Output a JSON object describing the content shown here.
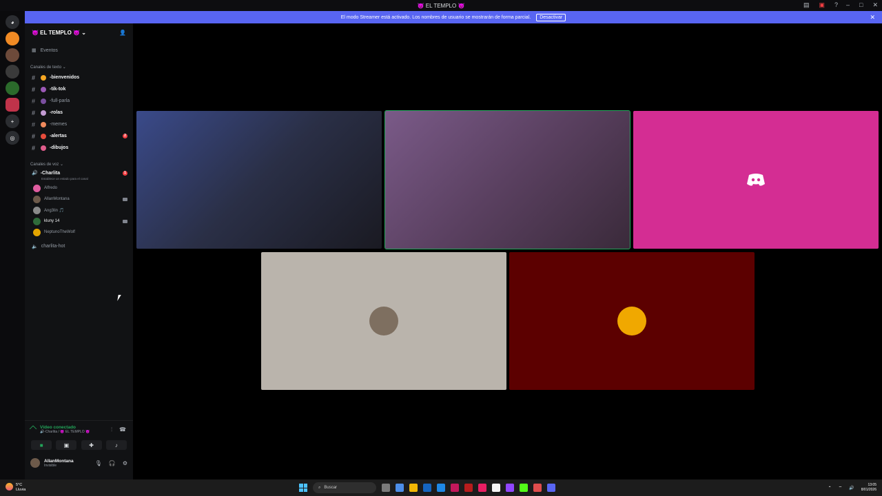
{
  "window": {
    "title": "👿 EL TEMPLO 👿",
    "minimize": "–",
    "maximize": "□",
    "close": "✕"
  },
  "streamer_banner": {
    "text": "El modo Streamer está activado. Los nombres de usuario se mostrarán de forma parcial.",
    "button": "Desactivar",
    "close": "✕"
  },
  "server": {
    "name": "👿 EL TEMPLO 👿",
    "events_label": "Eventos",
    "text_category": "Canales de texto",
    "voice_category": "Canales de voz",
    "text_channels": [
      {
        "name": "-bienvenidos",
        "unread": true,
        "emoji_color": "#f5a623"
      },
      {
        "name": "-tik-tok",
        "unread": true,
        "emoji_color": "#9b59b6"
      },
      {
        "name": "-full-parla",
        "unread": false,
        "emoji_color": "#7b4fa0"
      },
      {
        "name": "-rolas",
        "unread": true,
        "emoji_color": "#c39bd3"
      },
      {
        "name": "-memes",
        "unread": false,
        "emoji_color": "#f08a5d"
      },
      {
        "name": "-alertas",
        "unread": true,
        "emoji_color": "#e74c3c",
        "mention": "2"
      },
      {
        "name": "-dibujos",
        "unread": true,
        "emoji_color": "#e05d8c"
      }
    ],
    "voice_channel": {
      "name": "-Charlita",
      "status_placeholder": "Establece un estado para el canal",
      "mention": "1",
      "users": [
        {
          "name": "Alfredo",
          "avatar_color": "#e05da0",
          "camera": false,
          "bold": false
        },
        {
          "name": "AllanMontana",
          "avatar_color": "#6d5a4a",
          "camera": true,
          "bold": false
        },
        {
          "name": "Ang3lin 🎵",
          "avatar_color": "#8a8a8a",
          "camera": false,
          "bold": false
        },
        {
          "name": "kluny 14",
          "avatar_color": "#2f6b3a",
          "camera": true,
          "bold": true
        },
        {
          "name": "NeptunoTheWolf",
          "avatar_color": "#e2a400",
          "camera": false,
          "bold": false
        }
      ]
    },
    "other_voice_channel": "charlita-hot"
  },
  "voice_panel": {
    "status": "Vídeo conectado",
    "location": "🔊-Charlita / 👿 EL TEMPLO 👿"
  },
  "user": {
    "name": "AllanMontana",
    "status": "Invisible"
  },
  "video_tiles": [
    {
      "kind": "camera",
      "speaking": false,
      "colors": [
        "#3a4a8a",
        "#2a2f46",
        "#1a1a22"
      ]
    },
    {
      "kind": "camera",
      "speaking": true,
      "colors": [
        "#7a5a88",
        "#5a4060",
        "#3a2a3a"
      ]
    },
    {
      "kind": "logo",
      "speaking": false,
      "bg": "#d42d93"
    },
    {
      "kind": "avatar",
      "speaking": false,
      "bg": "#bab4ac",
      "avatar_color": "#7e6f60"
    },
    {
      "kind": "avatar",
      "speaking": false,
      "bg": "#5c0000",
      "avatar_color": "#f0a800"
    }
  ],
  "taskbar": {
    "weather_temp": "5°C",
    "weather_desc": "Lluvia",
    "search_placeholder": "Buscar",
    "time": "13:05",
    "date": "8/01/2026",
    "app_colors": [
      "#7a7a7a",
      "#4d8ee8",
      "#f2b705",
      "#1565c0",
      "#1e88e5",
      "#c2185b",
      "#b71c1c",
      "#e91e63",
      "#f5f5f5",
      "#9146ff",
      "#53fc18",
      "#e04d4d",
      "#5865f2"
    ]
  },
  "server_rail": {
    "servers": [
      "#f08a24",
      "#6d4a3a",
      "#3a3a3a",
      "#2b6a2b",
      "#c0334a"
    ]
  }
}
